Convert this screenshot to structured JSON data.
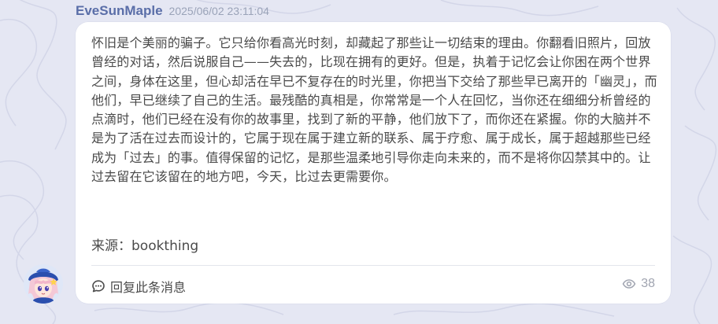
{
  "message": {
    "author": "EveSunMaple",
    "timestamp": "2025/06/02 23:11:04",
    "text": "怀旧是个美丽的骗子。它只给你看高光时刻，却藏起了那些让一切结束的理由。你翻看旧照片，回放曾经的对话，然后说服自己——失去的，比现在拥有的更好。但是，执着于记忆会让你困在两个世界之间，身体在这里，但心却活在早已不复存在的时光里，你把当下交给了那些早已离开的「幽灵」，而他们，早已继续了自己的生活。最残酷的真相是，你常常是一个人在回忆，当你还在细细分析曾经的点滴时，他们已经在没有你的故事里，找到了新的平静，他们放下了，而你还在紧握。你的大脑并不是为了活在过去而设计的，它属于现在属于建立新的联系、属于疗愈、属于成长，属于超越那些已经成为「过去」的事。值得保留的记忆，是那些温柔地引导你走向未来的，而不是将你囚禁其中的。让过去留在它该留在的地方吧，今天，比过去更需要你。",
    "source": "来源：bookthing",
    "reply_label": "回复此条消息",
    "view_count": "38"
  },
  "icons": {
    "reply": "chat-bubble-icon",
    "views": "eye-icon",
    "avatar": "anime-girl-avatar"
  },
  "colors": {
    "background": "#e5e7f3",
    "author": "#5a6ea8",
    "timestamp": "#9aa3b8",
    "bubble": "#ffffff",
    "text": "#4a4a4a",
    "muted": "#a0a4b0"
  }
}
